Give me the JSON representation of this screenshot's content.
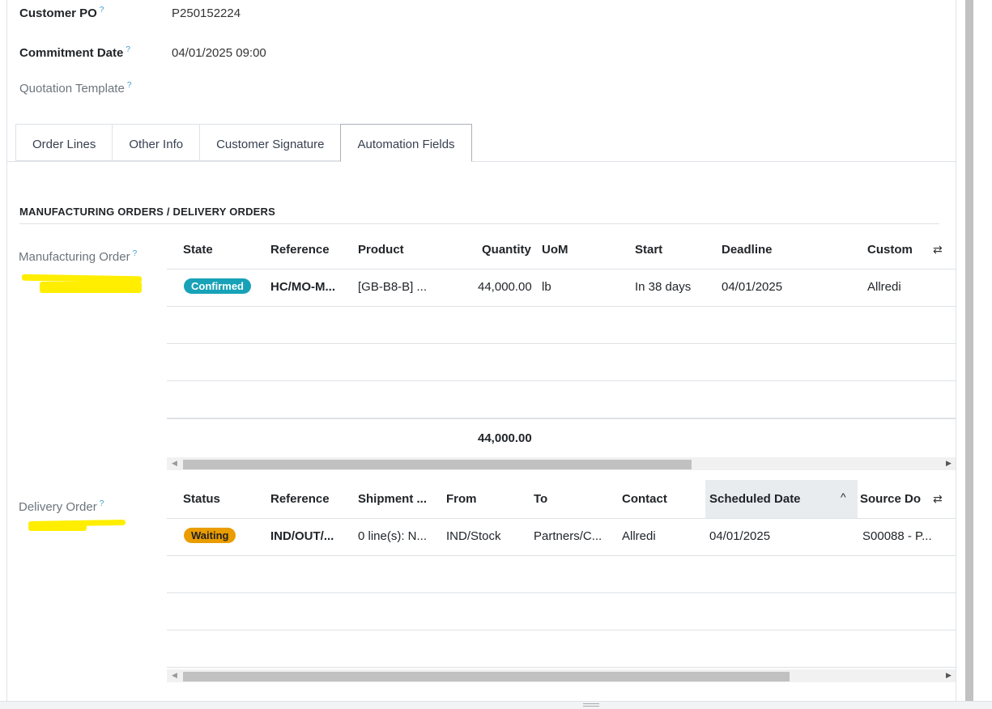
{
  "fields": {
    "customer_po": {
      "label": "Customer PO",
      "help": "?",
      "value": "P250152224"
    },
    "commitment_date": {
      "label": "Commitment Date",
      "help": "?",
      "value": "04/01/2025 09:00"
    },
    "quotation_template": {
      "label": "Quotation Template",
      "help": "?",
      "value": ""
    }
  },
  "tabs": [
    {
      "label": "Order Lines"
    },
    {
      "label": "Other Info"
    },
    {
      "label": "Customer Signature"
    },
    {
      "label": "Automation Fields"
    }
  ],
  "section_title": "MANUFACTURING ORDERS / DELIVERY ORDERS",
  "manufacturing": {
    "label": "Manufacturing Order",
    "help": "?",
    "headers": [
      "State",
      "Reference",
      "Product",
      "Quantity",
      "UoM",
      "Start",
      "Deadline",
      "Custom"
    ],
    "row": {
      "state": "Confirmed",
      "reference": "HC/MO-M...",
      "product": "[GB-B8-B] ...",
      "quantity": "44,000.00",
      "uom": "lb",
      "start": "In 38 days",
      "deadline": "04/01/2025",
      "customer": "Allredi"
    },
    "total": "44,000.00",
    "colors": {
      "state_badge": "#17a2b8"
    }
  },
  "delivery": {
    "label": "Delivery Order",
    "help": "?",
    "headers": [
      "Status",
      "Reference",
      "Shipment ...",
      "From",
      "To",
      "Contact",
      "Scheduled Date",
      "Source Do"
    ],
    "sort_icon": "^",
    "row": {
      "status": "Waiting",
      "reference": "IND/OUT/...",
      "shipment": "0 line(s): N...",
      "from": "IND/Stock",
      "to": "Partners/C...",
      "contact": "Allredi",
      "scheduled_date": "04/01/2025",
      "source": "S00088 - P..."
    },
    "colors": {
      "status_badge": "#e99d00"
    }
  },
  "icons": {
    "column_config": "sliders-icon",
    "scroll_left": "scroll-left-arrow-icon",
    "scroll_right": "scroll-right-arrow-icon"
  }
}
